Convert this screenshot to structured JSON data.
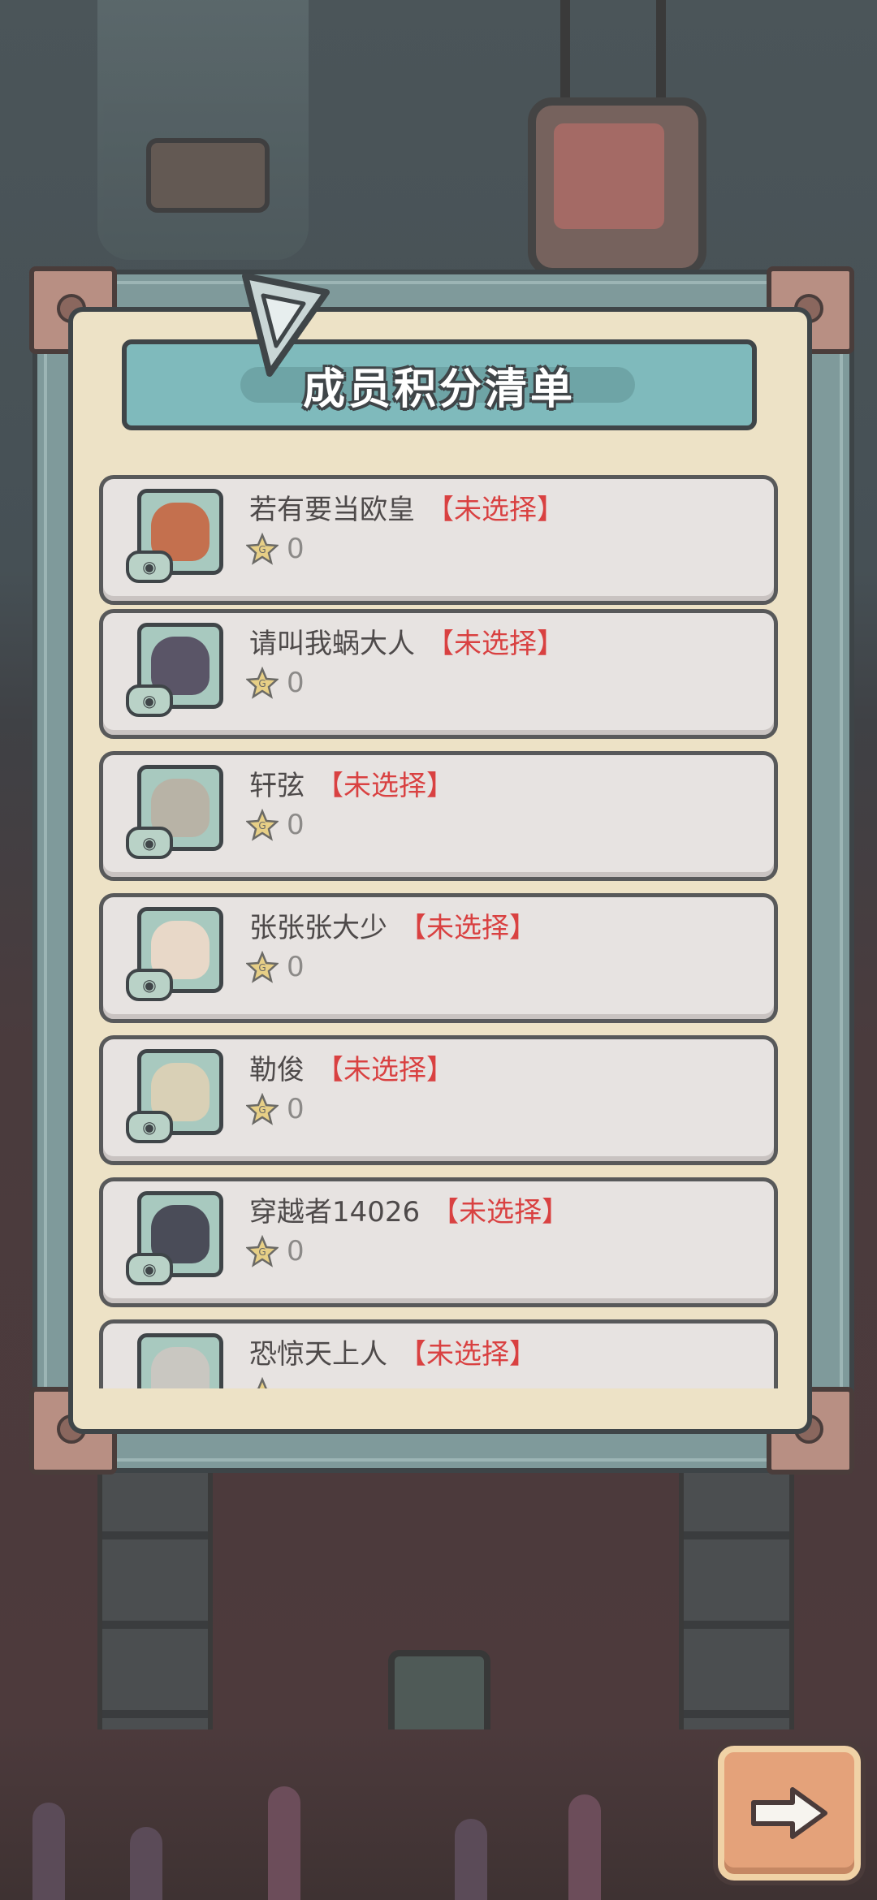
{
  "panel": {
    "title": "成员积分清单"
  },
  "members": [
    {
      "name": "若有要当欧皇",
      "status": "【未选择】",
      "score": "0",
      "avatar_color": "#c4704e"
    },
    {
      "name": "请叫我蜗大人",
      "status": "【未选择】",
      "score": "0",
      "avatar_color": "#5a5567"
    },
    {
      "name": "轩弦",
      "status": "【未选择】",
      "score": "0",
      "avatar_color": "#b8b3a6"
    },
    {
      "name": "张张张大少",
      "status": "【未选择】",
      "score": "0",
      "avatar_color": "#e8d8c8"
    },
    {
      "name": "勒俊",
      "status": "【未选择】",
      "score": "0",
      "avatar_color": "#d9d0b6"
    },
    {
      "name": "穿越者14026",
      "status": "【未选择】",
      "score": "0",
      "avatar_color": "#4a4c58"
    },
    {
      "name": "恐惊天上人",
      "status": "【未选择】",
      "score": "",
      "avatar_color": "#c9c7c1"
    }
  ],
  "icons": {
    "score": "star-icon",
    "view": "eye-icon",
    "next": "arrow-right-icon"
  },
  "colors": {
    "status_red": "#d94141",
    "title_plate": "#7fbabc",
    "panel_bg": "#ede2c6"
  }
}
